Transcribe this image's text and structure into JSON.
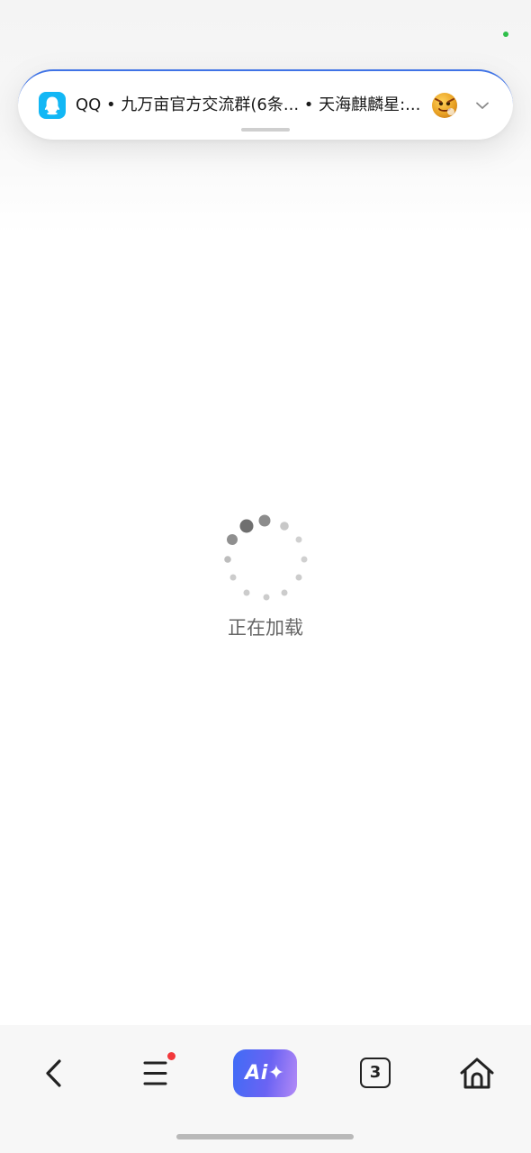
{
  "status_bar": {
    "indicator_color": "#2fbf4a"
  },
  "notification": {
    "app_icon": "qq-penguin-icon",
    "text": "QQ • 九万亩官方交流群(6条... • 天海麒麟星:...",
    "avatar_icon": "sender-avatar-icon",
    "expand_icon": "chevron-down-icon",
    "accent_color": "#3f73e6"
  },
  "loading": {
    "spinner_icon": "loading-spinner-icon",
    "text": "正在加载"
  },
  "bottom_nav": {
    "back_icon": "back-chevron-icon",
    "menu_icon": "menu-icon",
    "menu_badge_color": "#f2383b",
    "ai_label": "Ai✦",
    "ai_gradient": [
      "#3f6cf6",
      "#b48af6"
    ],
    "tabs_count": "3",
    "home_icon": "home-icon"
  }
}
